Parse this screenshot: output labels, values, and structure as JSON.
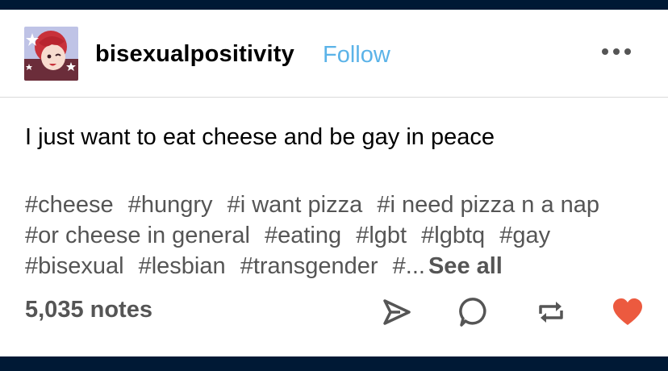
{
  "post": {
    "blog_name": "bisexualpositivity",
    "follow_label": "Follow",
    "body": "I just want to eat cheese and be gay in peace",
    "tags": [
      "#cheese",
      "#hungry",
      "#i want pizza",
      "#i need pizza n a nap",
      "#or cheese in general",
      "#eating",
      "#lgbt",
      "#lgbtq",
      "#gay",
      "#bisexual",
      "#lesbian",
      "#transgender",
      "#..."
    ],
    "see_all_label": "See all",
    "notes": "5,035 notes"
  },
  "icons": {
    "more": "more-options-icon",
    "share": "send-icon",
    "reply": "reply-bubble-icon",
    "reblog": "reblog-icon",
    "like": "heart-icon"
  },
  "colors": {
    "background": "#001935",
    "follow": "#5bb3e8",
    "like": "#ec5a3f",
    "tags": "#555555"
  }
}
